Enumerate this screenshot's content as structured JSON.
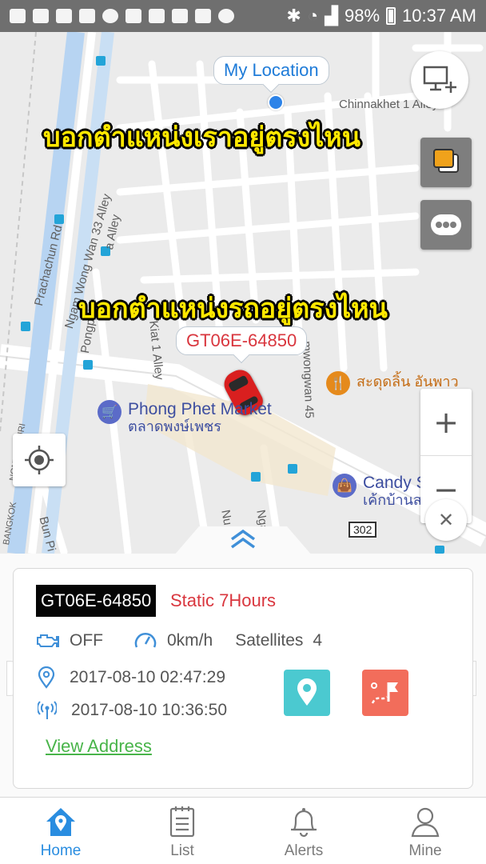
{
  "status_bar": {
    "battery": "98%",
    "time": "10:37 AM"
  },
  "map": {
    "road_labels": [
      "Chinnakhet 1 Alley",
      "Prachachun Rd",
      "Ngam Wong Wan 33 Alley",
      "a Alley",
      "Pongpet",
      "Kiat 1 Alley",
      "mwongwan 45",
      "NONTHABURI",
      "BANGKOK",
      "Bun Pi",
      "Ngam Wo",
      "Nu",
      "302"
    ],
    "my_location_label": "My Location",
    "vehicle_label": "GT06E-64850",
    "overlay_text_top": "บอกตำแหน่งเราอยู่ตรงไหน",
    "overlay_text_middle": "บอกตำแหน่งรถอยู่ตรงไหน",
    "poi": {
      "market_name": "Phong Phet Market",
      "market_thai": "ตลาดพงษ์เพชร",
      "store_name": "Candy Store",
      "store_thai": "เค้กบ้านสวน",
      "food_name": "สะดุดลิ้น อันพาว"
    },
    "zoom_in": "+",
    "zoom_out": "−",
    "close": "✕"
  },
  "info": {
    "plate": "GT06E-64850",
    "status": "Static 7Hours",
    "engine_status": "OFF",
    "speed": "0km/h",
    "satellites_label": "Satellites",
    "satellites_count": "4",
    "gps_time": "2017-08-10 02:47:29",
    "signal_time": "2017-08-10 10:36:50",
    "view_address": "View Address"
  },
  "nav": {
    "home": "Home",
    "list": "List",
    "alerts": "Alerts",
    "mine": "Mine"
  },
  "colors": {
    "accent": "#2a8de0",
    "status_red": "#d9363e",
    "link_green": "#48b449",
    "nav_teal": "#4bc9d0",
    "route_coral": "#f26d5b"
  }
}
